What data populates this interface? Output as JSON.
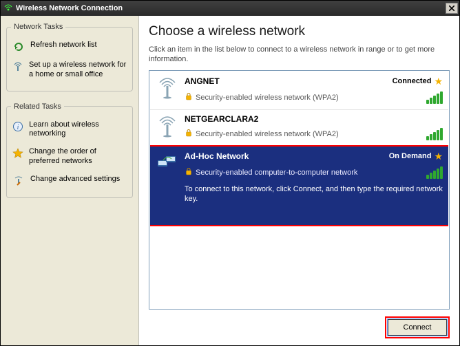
{
  "window": {
    "title": "Wireless Network Connection"
  },
  "left": {
    "group1_title": "Network Tasks",
    "task_refresh": "Refresh network list",
    "task_setup": "Set up a wireless network for a home or small office",
    "group2_title": "Related Tasks",
    "task_learn": "Learn about wireless networking",
    "task_order": "Change the order of preferred networks",
    "task_advanced": "Change advanced settings"
  },
  "right": {
    "heading": "Choose a wireless network",
    "instruction": "Click an item in the list below to connect to a wireless network in range or to get more information.",
    "connect_btn": "Connect"
  },
  "networks": [
    {
      "name": "ANGNET",
      "status": "Connected",
      "starred": true,
      "security": "Security-enabled wireless network (WPA2)",
      "selected": false,
      "icon": "antenna"
    },
    {
      "name": "NETGEARCLARA2",
      "status": "",
      "starred": false,
      "security": "Security-enabled wireless network (WPA2)",
      "selected": false,
      "icon": "antenna"
    },
    {
      "name": "Ad-Hoc Network",
      "status": "On Demand",
      "starred": true,
      "security": "Security-enabled computer-to-computer network",
      "hint": "To connect to this network, click Connect, and then type the required network key.",
      "selected": true,
      "icon": "adhoc"
    }
  ]
}
